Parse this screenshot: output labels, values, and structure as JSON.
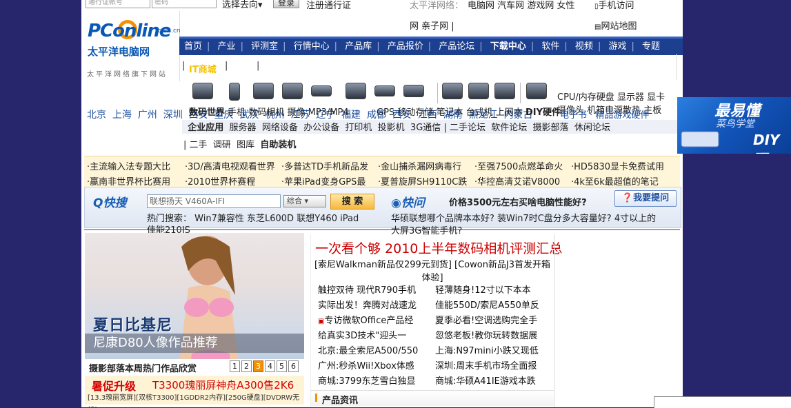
{
  "login": {
    "user_placeholder": "通行证帐号",
    "pass_placeholder": "密码",
    "select_label": "选择去向",
    "login_button": "登录",
    "register": "注册通行证"
  },
  "network": {
    "label": "太平洋网络：",
    "sites": [
      "电脑网",
      "汽车网",
      "游戏网",
      "女性"
    ],
    "mobile": "手机访问",
    "sites2": "网 亲子网 |",
    "sitemap": "网站地图"
  },
  "logo": {
    "word": "PConline",
    "domain": ".com.cn",
    "cn": "太平洋电脑网",
    "tagline": "太平洋网络旗下网站"
  },
  "nav": [
    "首页",
    "产业",
    "评测室",
    "行情中心",
    "产品库",
    "产品报价",
    "产品论坛",
    "下载中心",
    "软件",
    "视频",
    "游戏",
    "专题"
  ],
  "nav_highlight": "下载中心",
  "itmall": "IT商城",
  "cities": [
    "北京",
    "上海",
    "广州",
    "深圳",
    "西安",
    "重庆",
    "武汉",
    "杭州",
    "江苏",
    "辽宁",
    "福建",
    "成都",
    "西安",
    "江西",
    "湖南",
    "黑龙江",
    "内蒙古"
  ],
  "city_end": "山东",
  "categories": {
    "row1": [
      "数码世界",
      "手机",
      "数码相机",
      "摄像",
      "MP3/MP4",
      "GPS",
      "移动存储",
      "笔记本",
      "台式机",
      "上网本",
      "DIY硬件"
    ],
    "row1_right": "CPU/内存硬盘 显示器 显卡",
    "row1_right2": "摄像头 机箱电源散热 主板",
    "row1_extra": "电子书 · 精品游戏硬件",
    "row2": [
      "企业应用",
      "服务器",
      "网络设备",
      "办公设备",
      "打印机",
      "投影机",
      "3G通信",
      "二手论坛",
      "软件论坛",
      "摄影部落",
      "休闲论坛"
    ],
    "row3": [
      "二手",
      "调研",
      "图库",
      "自助装机"
    ]
  },
  "ticker": {
    "row1": [
      "·主流输入法专题大比",
      "·3D/高清电视观看世界",
      "·多普达TD手机新品发",
      "·金山捕杀漏网病毒行",
      "·至强7500点燃革命火",
      "·HD5830显卡免费试用"
    ],
    "row2": [
      "·赢南非世界杯比赛用",
      "·2010世界杯赛程",
      "·苹果iPad变身GPS最",
      "·夏普旋屏SH9110C跌",
      "·华控高清艾诺V8000",
      "·4k至6k最超值的笔记"
    ]
  },
  "search": {
    "title": "快搜",
    "placeholder": "联想扬天 V460A-IFI",
    "select": "综合",
    "button": "搜 索",
    "hot_label": "热门搜索：",
    "hot": [
      "Win7兼容性",
      "东芝L600D",
      "联想Y460",
      "iPad",
      "佳能210IS"
    ]
  },
  "ask": {
    "title": "快问",
    "question": "价格3500元左右买啥电脑性能好?",
    "button": "我要提问",
    "q2": "华硕联想哪个品牌本本好? 装Win7时C盘分多大容量好? 4寸以上的",
    "q3": "大屏3G智能手机?"
  },
  "promo": {
    "title": "夏日比基尼",
    "subtitle": "尼康D80人像作品推荐",
    "caption": "摄影部落本周热门作品欣赏",
    "pages": [
      "1",
      "2",
      "3",
      "4",
      "5",
      "6"
    ],
    "active_page": "3",
    "ad_label": "暑促升级",
    "ad_text": "T3300瑰丽屏神舟A300售2K6",
    "ad_detail": "[13.3瑰丽宽屏][双核T3300][1GDDR2内存][250G硬盘][DVDRW无线]"
  },
  "news": {
    "headline": "一次看个够 2010上半年数码相机评测汇总",
    "subhead": "[索尼Walkman新品仅299元到货] [Cowon新品J3首发开箱体验]",
    "left": [
      "触控双待 现代R790手机",
      "实际出发！奔腾对战速龙",
      "专访微软Office产品经",
      "给真实3D技术\"迎头一",
      "北京:最全索尼A500/550",
      "广州:秒杀Wii!Xbox体感",
      "商城:3799东芝雪白独显"
    ],
    "right": [
      "轻薄随身!12寸以下本本",
      "佳能550D/索尼A550单反",
      "夏季必看!空调选购完全手",
      "忽悠老板!教你玩转数据展",
      "上海:N97mini小跌又现低",
      "深圳:周末手机市场全面报",
      "商城:华硕A41IE游戏本跌"
    ],
    "section": "产品资讯"
  },
  "right_ad": {
    "t1": "最易懂",
    "t2": "菜鸟学堂",
    "t3": "DIY硬"
  }
}
